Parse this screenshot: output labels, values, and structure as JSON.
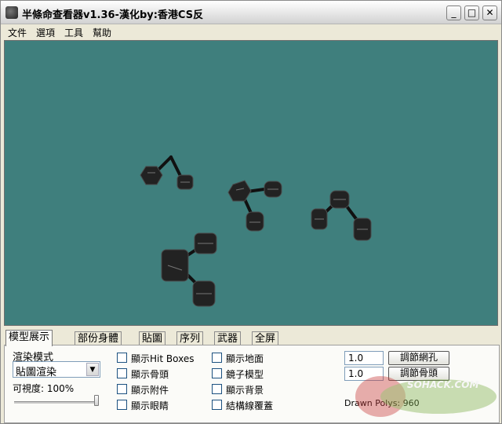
{
  "window": {
    "title": "半條命查看器v1.36-漢化by:香港CS反",
    "min_glyph": "_",
    "max_glyph": "□",
    "close_glyph": "✕",
    "icon": "app-skull-icon"
  },
  "menu": [
    "文件",
    "選項",
    "工具",
    "幫助"
  ],
  "viewport": {
    "background": "#3f7f7d"
  },
  "tabs": [
    {
      "label": "模型展示",
      "active": true
    },
    {
      "label": "部份身體",
      "active": false
    },
    {
      "label": "貼圖",
      "active": false
    },
    {
      "label": "序列",
      "active": false
    },
    {
      "label": "武器",
      "active": false
    },
    {
      "label": "全屏",
      "active": false
    }
  ],
  "panel": {
    "render_mode_label": "渲染模式",
    "render_mode_value": "貼圖渲染",
    "opacity_label": "可視度: 100%",
    "opacity_fraction": 1.0,
    "checkboxes_col1": [
      "顯示Hit Boxes",
      "顯示骨頭",
      "顯示附件",
      "顯示眼睛"
    ],
    "checkboxes_col2": [
      "顯示地面",
      "鏡子模型",
      "顯示背景",
      "結構線覆蓋"
    ],
    "grid_value": "1.0",
    "grid_button": "調節網孔",
    "bone_value": "1.0",
    "bone_button": "調節骨頭",
    "drawn_polys": "Drawn Polys: 960"
  },
  "watermark": {
    "text": "SOHACK.COM"
  }
}
